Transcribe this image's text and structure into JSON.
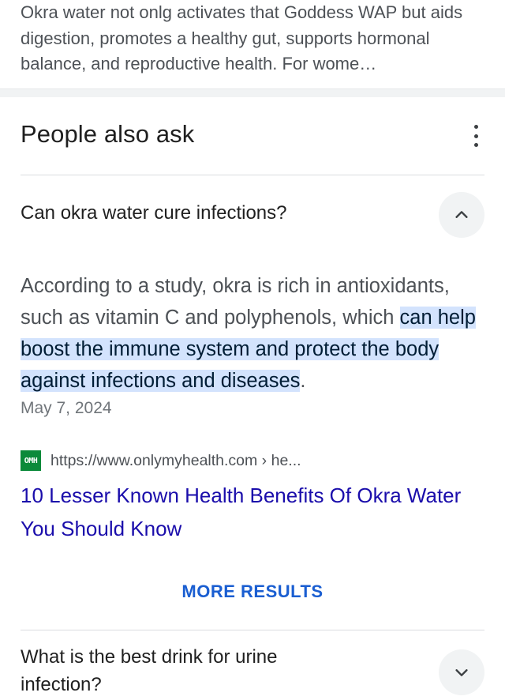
{
  "snippet": {
    "text": "Okra water not onlg activates that Goddess WAP but aids digestion, promotes a healthy gut, supports hormonal balance, and reproductive health. For wome…"
  },
  "paa": {
    "title": "People also ask",
    "menu_icon": "more-vert-icon",
    "questions": [
      {
        "question": "Can okra water cure infections?",
        "expanded": true,
        "answer_before": "According to a study, okra is rich in antioxidants, such as vitamin C and polyphenols, which ",
        "answer_highlight": "can help boost the immune system and protect the body against infections and diseases",
        "answer_after": ".",
        "date": "May 7, 2024",
        "source_icon_text": "OMH",
        "source_url": "https://www.onlymyhealth.com › he...",
        "result_title": "10 Lesser Known Health Benefits Of Okra Water You Should Know"
      },
      {
        "question": "What is the best drink for urine infection?",
        "expanded": false
      }
    ],
    "more_results": "MORE RESULTS"
  },
  "colors": {
    "link": "#1a0dab",
    "highlight": "#d3e3fd",
    "more_results": "#1a5ed1",
    "favicon": "#0b8a3a"
  }
}
